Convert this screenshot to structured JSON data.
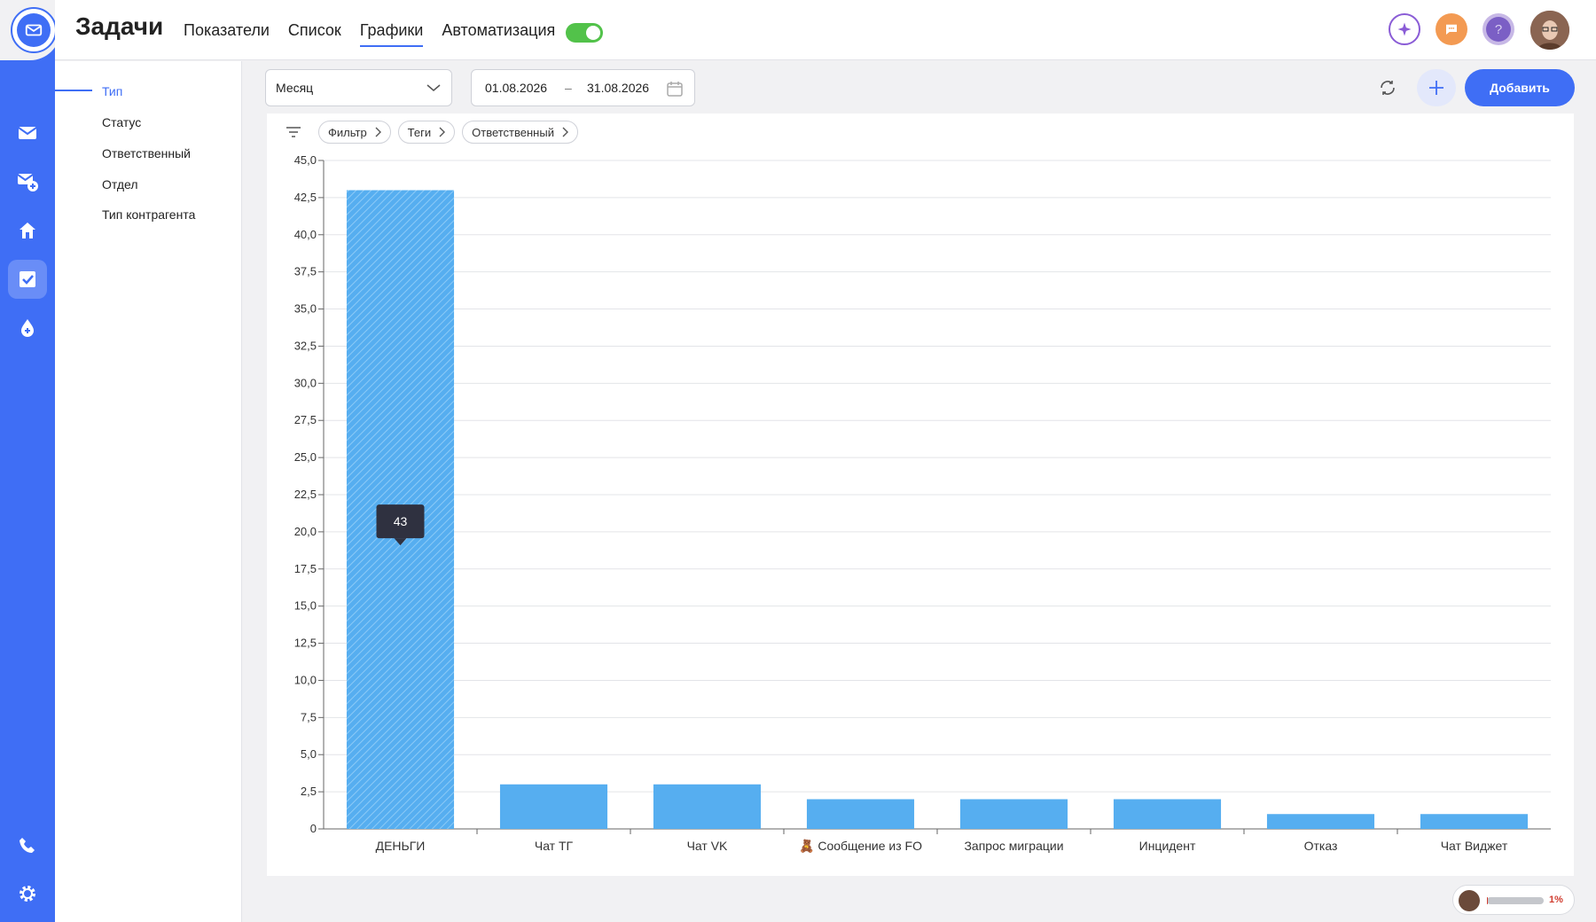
{
  "app": {
    "title": "Задачи",
    "nav": [
      "Показатели",
      "Список",
      "Графики",
      "Автоматизация"
    ],
    "nav_active": 2,
    "accent": "#3f6ef5",
    "toggle_on": true
  },
  "rail": {
    "icons": [
      "mail-icon",
      "mail-add-icon",
      "house-icon",
      "checkbox-icon",
      "drop-icon",
      "phone-icon",
      "gear-icon"
    ],
    "active": "checkbox-icon"
  },
  "sidebar": {
    "items": [
      "Тип",
      "Статус",
      "Ответственный",
      "Отдел",
      "Тип контрагента"
    ],
    "active": 0
  },
  "toolbar": {
    "period": "Месяц",
    "date_from": "01.08.2026",
    "date_sep": "–",
    "date_to": "31.08.2026",
    "add_label": "Добавить"
  },
  "filters": [
    "Фильтр",
    "Теги",
    "Ответственный"
  ],
  "chart_data": {
    "type": "bar",
    "categories": [
      "ДЕНЬГИ",
      "Чат ТГ",
      "Чат VK",
      "🧸 Сообщение из FO",
      "Запрос миграции",
      "Инцидент",
      "Отказ",
      "Чат Виджет"
    ],
    "values": [
      43,
      3,
      3,
      2,
      2,
      2,
      1,
      1
    ],
    "ylim": [
      0,
      45
    ],
    "ytick_step": 2.5,
    "ytick_labels": [
      "0",
      "2,5",
      "5,0",
      "7,5",
      "10,0",
      "12,5",
      "15,0",
      "17,5",
      "20,0",
      "22,5",
      "25,0",
      "27,5",
      "30,0",
      "32,5",
      "35,0",
      "37,5",
      "40,0",
      "42,5",
      "45,0"
    ],
    "grid": true,
    "bar_color": "#56aef0",
    "highlighted": 0,
    "tooltip": "43"
  },
  "footer": {
    "progress": 0.01,
    "label": "1%"
  }
}
